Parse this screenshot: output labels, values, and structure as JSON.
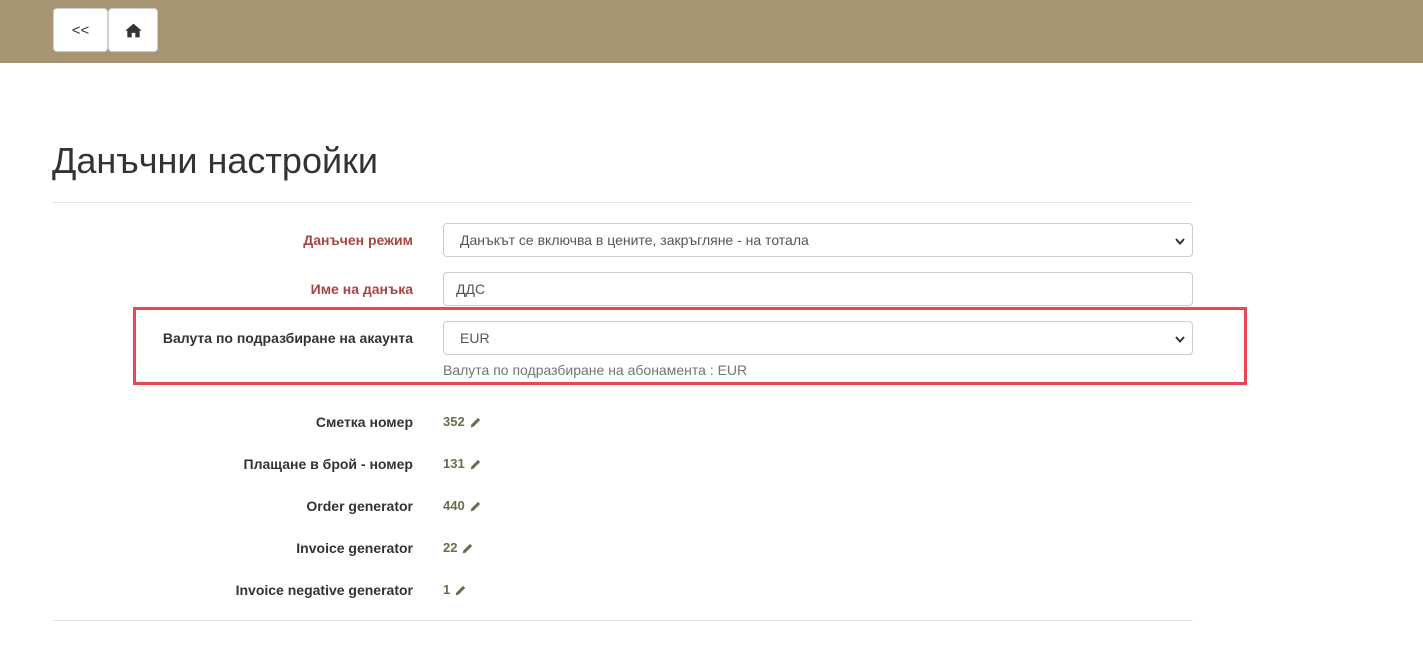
{
  "nav": {
    "back_label": "<<"
  },
  "page_title": "Данъчни настройки",
  "form": {
    "tax_mode": {
      "label": "Данъчен режим",
      "value": "Данъкът се включва в цените, закръгляне - на тотала"
    },
    "tax_name": {
      "label": "Име на данъка",
      "value": "ДДС"
    },
    "currency": {
      "label": "Валута по подразбиране на акаунта",
      "value": "EUR",
      "help": "Валута по подразбиране на абонамента : EUR"
    }
  },
  "counters": [
    {
      "label": "Сметка номер",
      "value": "352"
    },
    {
      "label": "Плащане в брой - номер",
      "value": "131"
    },
    {
      "label": "Order generator",
      "value": "440"
    },
    {
      "label": "Invoice generator",
      "value": "22"
    },
    {
      "label": "Invoice negative generator",
      "value": "1"
    }
  ],
  "colors": {
    "header_bg": "#a69472",
    "required_label": "#a94442",
    "highlight_border": "#e8474f",
    "counter_value": "#6b6b50"
  },
  "icons": {
    "home": "home-icon",
    "edit": "pencil-icon",
    "dropdown": "chevron-down-icon"
  }
}
